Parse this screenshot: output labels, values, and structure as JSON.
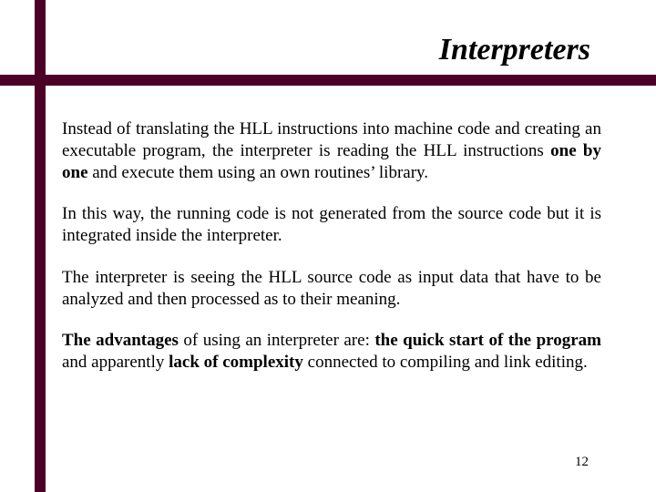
{
  "title": "Interpreters",
  "body": {
    "p1": {
      "a": "Instead of translating the HLL instructions into machine code and creating an executable program, the interpreter is reading the HLL instructions ",
      "b": "one by one",
      "c": " and execute them using an own routines’ library."
    },
    "p2": "In this way, the running code is not generated from the source code but it is integrated inside the interpreter.",
    "p3": "The interpreter is seeing the HLL source code as input data that have to be analyzed and then processed as to their meaning.",
    "p4": {
      "a": "The advantages",
      "b": " of using an interpreter are: ",
      "c": "the quick start of the program",
      "d": " and apparently ",
      "e": "lack of complexity",
      "f": " connected to compiling and link editing."
    }
  },
  "page": "12",
  "colors": {
    "accent": "#4d0026"
  }
}
